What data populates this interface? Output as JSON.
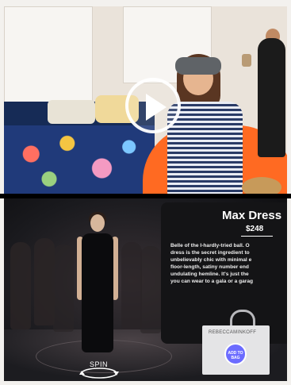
{
  "video": {
    "play_icon": "play-icon"
  },
  "product": {
    "title": "Max Dress",
    "price": "$248",
    "description_lines": [
      "Belle of the I-hardly-tried ball. O",
      "dress is the secret ingredient to",
      "unbelievably chic with minimal e",
      "floor-length, satiny number end",
      "undulating hemline. It's just the",
      "you can wear to a gala or a garag"
    ],
    "bag_brand": "REBECCAMINKOFF",
    "add_to_bag_label": "ADD TO BAG"
  },
  "vr": {
    "spin_label": "SPIN",
    "spin_icon": "spin-icon"
  }
}
